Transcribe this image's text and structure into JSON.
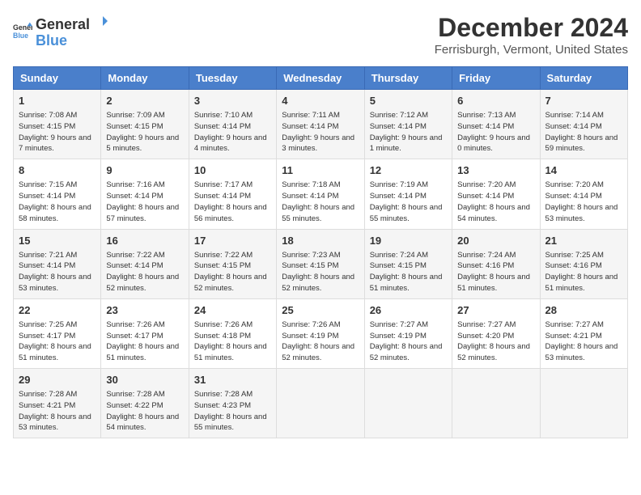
{
  "logo": {
    "general": "General",
    "blue": "Blue"
  },
  "title": "December 2024",
  "subtitle": "Ferrisburgh, Vermont, United States",
  "days_of_week": [
    "Sunday",
    "Monday",
    "Tuesday",
    "Wednesday",
    "Thursday",
    "Friday",
    "Saturday"
  ],
  "weeks": [
    [
      {
        "day": "1",
        "sunrise": "7:08 AM",
        "sunset": "4:15 PM",
        "daylight": "9 hours and 7 minutes."
      },
      {
        "day": "2",
        "sunrise": "7:09 AM",
        "sunset": "4:15 PM",
        "daylight": "9 hours and 5 minutes."
      },
      {
        "day": "3",
        "sunrise": "7:10 AM",
        "sunset": "4:14 PM",
        "daylight": "9 hours and 4 minutes."
      },
      {
        "day": "4",
        "sunrise": "7:11 AM",
        "sunset": "4:14 PM",
        "daylight": "9 hours and 3 minutes."
      },
      {
        "day": "5",
        "sunrise": "7:12 AM",
        "sunset": "4:14 PM",
        "daylight": "9 hours and 1 minute."
      },
      {
        "day": "6",
        "sunrise": "7:13 AM",
        "sunset": "4:14 PM",
        "daylight": "9 hours and 0 minutes."
      },
      {
        "day": "7",
        "sunrise": "7:14 AM",
        "sunset": "4:14 PM",
        "daylight": "8 hours and 59 minutes."
      }
    ],
    [
      {
        "day": "8",
        "sunrise": "7:15 AM",
        "sunset": "4:14 PM",
        "daylight": "8 hours and 58 minutes."
      },
      {
        "day": "9",
        "sunrise": "7:16 AM",
        "sunset": "4:14 PM",
        "daylight": "8 hours and 57 minutes."
      },
      {
        "day": "10",
        "sunrise": "7:17 AM",
        "sunset": "4:14 PM",
        "daylight": "8 hours and 56 minutes."
      },
      {
        "day": "11",
        "sunrise": "7:18 AM",
        "sunset": "4:14 PM",
        "daylight": "8 hours and 55 minutes."
      },
      {
        "day": "12",
        "sunrise": "7:19 AM",
        "sunset": "4:14 PM",
        "daylight": "8 hours and 55 minutes."
      },
      {
        "day": "13",
        "sunrise": "7:20 AM",
        "sunset": "4:14 PM",
        "daylight": "8 hours and 54 minutes."
      },
      {
        "day": "14",
        "sunrise": "7:20 AM",
        "sunset": "4:14 PM",
        "daylight": "8 hours and 53 minutes."
      }
    ],
    [
      {
        "day": "15",
        "sunrise": "7:21 AM",
        "sunset": "4:14 PM",
        "daylight": "8 hours and 53 minutes."
      },
      {
        "day": "16",
        "sunrise": "7:22 AM",
        "sunset": "4:14 PM",
        "daylight": "8 hours and 52 minutes."
      },
      {
        "day": "17",
        "sunrise": "7:22 AM",
        "sunset": "4:15 PM",
        "daylight": "8 hours and 52 minutes."
      },
      {
        "day": "18",
        "sunrise": "7:23 AM",
        "sunset": "4:15 PM",
        "daylight": "8 hours and 52 minutes."
      },
      {
        "day": "19",
        "sunrise": "7:24 AM",
        "sunset": "4:15 PM",
        "daylight": "8 hours and 51 minutes."
      },
      {
        "day": "20",
        "sunrise": "7:24 AM",
        "sunset": "4:16 PM",
        "daylight": "8 hours and 51 minutes."
      },
      {
        "day": "21",
        "sunrise": "7:25 AM",
        "sunset": "4:16 PM",
        "daylight": "8 hours and 51 minutes."
      }
    ],
    [
      {
        "day": "22",
        "sunrise": "7:25 AM",
        "sunset": "4:17 PM",
        "daylight": "8 hours and 51 minutes."
      },
      {
        "day": "23",
        "sunrise": "7:26 AM",
        "sunset": "4:17 PM",
        "daylight": "8 hours and 51 minutes."
      },
      {
        "day": "24",
        "sunrise": "7:26 AM",
        "sunset": "4:18 PM",
        "daylight": "8 hours and 51 minutes."
      },
      {
        "day": "25",
        "sunrise": "7:26 AM",
        "sunset": "4:19 PM",
        "daylight": "8 hours and 52 minutes."
      },
      {
        "day": "26",
        "sunrise": "7:27 AM",
        "sunset": "4:19 PM",
        "daylight": "8 hours and 52 minutes."
      },
      {
        "day": "27",
        "sunrise": "7:27 AM",
        "sunset": "4:20 PM",
        "daylight": "8 hours and 52 minutes."
      },
      {
        "day": "28",
        "sunrise": "7:27 AM",
        "sunset": "4:21 PM",
        "daylight": "8 hours and 53 minutes."
      }
    ],
    [
      {
        "day": "29",
        "sunrise": "7:28 AM",
        "sunset": "4:21 PM",
        "daylight": "8 hours and 53 minutes."
      },
      {
        "day": "30",
        "sunrise": "7:28 AM",
        "sunset": "4:22 PM",
        "daylight": "8 hours and 54 minutes."
      },
      {
        "day": "31",
        "sunrise": "7:28 AM",
        "sunset": "4:23 PM",
        "daylight": "8 hours and 55 minutes."
      },
      null,
      null,
      null,
      null
    ]
  ]
}
